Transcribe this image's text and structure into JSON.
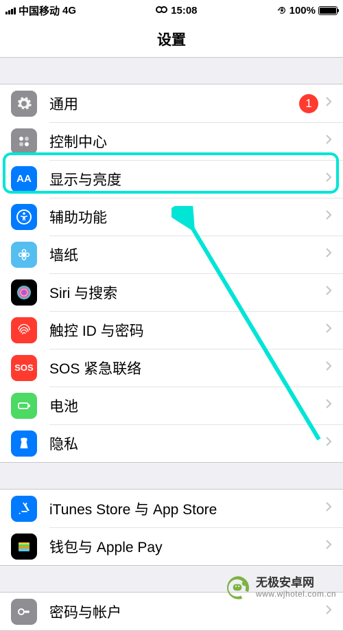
{
  "status": {
    "carrier": "中国移动",
    "network": "4G",
    "time": "15:08",
    "battery_pct": "100%"
  },
  "nav": {
    "title": "设置"
  },
  "group1": [
    {
      "key": "general",
      "label": "通用",
      "badge": "1"
    },
    {
      "key": "control",
      "label": "控制中心"
    },
    {
      "key": "display",
      "label": "显示与亮度"
    },
    {
      "key": "access",
      "label": "辅助功能"
    },
    {
      "key": "wallpaper",
      "label": "墙纸"
    },
    {
      "key": "siri",
      "label": "Siri 与搜索"
    },
    {
      "key": "touchid",
      "label": "触控 ID 与密码"
    },
    {
      "key": "sos",
      "label": "SOS 紧急联络"
    },
    {
      "key": "battery",
      "label": "电池"
    },
    {
      "key": "privacy",
      "label": "隐私"
    }
  ],
  "group2": [
    {
      "key": "itunes",
      "label": "iTunes Store 与 App Store"
    },
    {
      "key": "wallet",
      "label": "钱包与 Apple Pay"
    }
  ],
  "group3": [
    {
      "key": "passwords",
      "label": "密码与帐户"
    }
  ],
  "icons": {
    "sos_text": "SOS",
    "display_text": "AA"
  },
  "watermark": {
    "cn": "无极安卓网",
    "en": "www.wjhotel.com.cn"
  }
}
